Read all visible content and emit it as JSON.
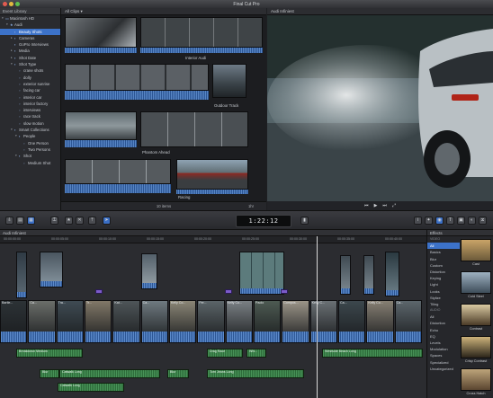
{
  "window": {
    "title": "Final Cut Pro"
  },
  "library": {
    "header": "Event Library",
    "rows": [
      {
        "label": "Macintosh HD",
        "indent": 0,
        "tri": "▾",
        "kind": "drive"
      },
      {
        "label": "Audi",
        "indent": 1,
        "tri": "▾",
        "kind": "event"
      },
      {
        "label": "Beauty Shots",
        "indent": 2,
        "tri": "",
        "kind": "star",
        "selected": true
      },
      {
        "label": "Cameras",
        "indent": 2,
        "tri": "▸",
        "kind": "folder"
      },
      {
        "label": "GoPro Interviews",
        "indent": 2,
        "tri": "",
        "kind": "star"
      },
      {
        "label": "Media",
        "indent": 2,
        "tri": "▸",
        "kind": "folder"
      },
      {
        "label": "Shot Date",
        "indent": 2,
        "tri": "▸",
        "kind": "folder"
      },
      {
        "label": "Shot Type",
        "indent": 2,
        "tri": "▾",
        "kind": "folder"
      },
      {
        "label": "crane shots",
        "indent": 3,
        "tri": "",
        "kind": "tag"
      },
      {
        "label": "dolly",
        "indent": 3,
        "tri": "",
        "kind": "tag"
      },
      {
        "label": "exterior sunrise",
        "indent": 3,
        "tri": "",
        "kind": "tag"
      },
      {
        "label": "facing car",
        "indent": 3,
        "tri": "",
        "kind": "tag"
      },
      {
        "label": "interior car",
        "indent": 3,
        "tri": "",
        "kind": "tag"
      },
      {
        "label": "interior factory",
        "indent": 3,
        "tri": "",
        "kind": "tag"
      },
      {
        "label": "interviews",
        "indent": 3,
        "tri": "",
        "kind": "tag"
      },
      {
        "label": "race track",
        "indent": 3,
        "tri": "",
        "kind": "tag"
      },
      {
        "label": "slow motion",
        "indent": 3,
        "tri": "",
        "kind": "tag"
      },
      {
        "label": "Smart Collections",
        "indent": 2,
        "tri": "▾",
        "kind": "folder"
      },
      {
        "label": "People",
        "indent": 3,
        "tri": "▾",
        "kind": "folder"
      },
      {
        "label": "One Person",
        "indent": 4,
        "tri": "",
        "kind": "tag"
      },
      {
        "label": "Two Persons",
        "indent": 4,
        "tri": "",
        "kind": "tag"
      },
      {
        "label": "Shot",
        "indent": 3,
        "tri": "▾",
        "kind": "folder"
      },
      {
        "label": "Medium Shot",
        "indent": 4,
        "tri": "",
        "kind": "tag"
      }
    ]
  },
  "browser": {
    "filter": "All Clips ▾",
    "clips": [
      {
        "label": "Interior Audi"
      },
      {
        "label": "Outdoor Track"
      },
      {
        "label": "Phantom Ahead"
      },
      {
        "label": "Racing"
      }
    ],
    "item_count": "10 items",
    "zoom": "1hr"
  },
  "viewer": {
    "title": "Audi Infiniest"
  },
  "toolbar": {
    "timecode": "1:22:12"
  },
  "timeline": {
    "title": "Audi Infiniest",
    "ruler": [
      "00:00:00:00",
      "00:00:05:00",
      "00:00:10:00",
      "00:00:15:00",
      "00:00:20:00",
      "00:00:25:00",
      "00:00:30:00",
      "00:00:35:00",
      "00:00:40:00"
    ],
    "story_clips": [
      "Bartle...",
      "Ca...",
      "Tra...",
      "Tr...",
      "Kat...",
      "Ca...",
      "Kelly Co...",
      "Fer...",
      "Kelly Co...",
      "Paolo",
      "Compos...",
      "Kelly C...",
      "Ca...",
      "Kelly Co...",
      "Ca..."
    ],
    "music": [
      {
        "label": "Breakdown Medium"
      },
      {
        "label": "Drag Race"
      },
      {
        "label": "Whi..."
      },
      {
        "label": "Westside Beach Long"
      },
      {
        "label": "Blur"
      },
      {
        "label": "Catwalk Long"
      },
      {
        "label": "Blur"
      },
      {
        "label": "Torn Jeans Long"
      },
      {
        "label": "Catwalk Long"
      }
    ]
  },
  "effects": {
    "header": "Effects",
    "categories": [
      {
        "label": "VIDEO",
        "head": true
      },
      {
        "label": "All",
        "selected": true
      },
      {
        "label": "Basics"
      },
      {
        "label": "Blur"
      },
      {
        "label": "Custom"
      },
      {
        "label": "Distortion"
      },
      {
        "label": "Keying"
      },
      {
        "label": "Light"
      },
      {
        "label": "Looks"
      },
      {
        "label": "Stylize"
      },
      {
        "label": "Tiling"
      },
      {
        "label": "AUDIO",
        "head": true
      },
      {
        "label": "All"
      },
      {
        "label": "Distortion"
      },
      {
        "label": "Echo"
      },
      {
        "label": "EQ"
      },
      {
        "label": "Levels"
      },
      {
        "label": "Modulation"
      },
      {
        "label": "Spaces"
      },
      {
        "label": "Specialized"
      },
      {
        "label": "Uncategorized"
      }
    ],
    "thumbs": [
      "Cast",
      "Cold Steel",
      "Contrast",
      "Crisp Contrast",
      "Cross Hatch"
    ]
  }
}
